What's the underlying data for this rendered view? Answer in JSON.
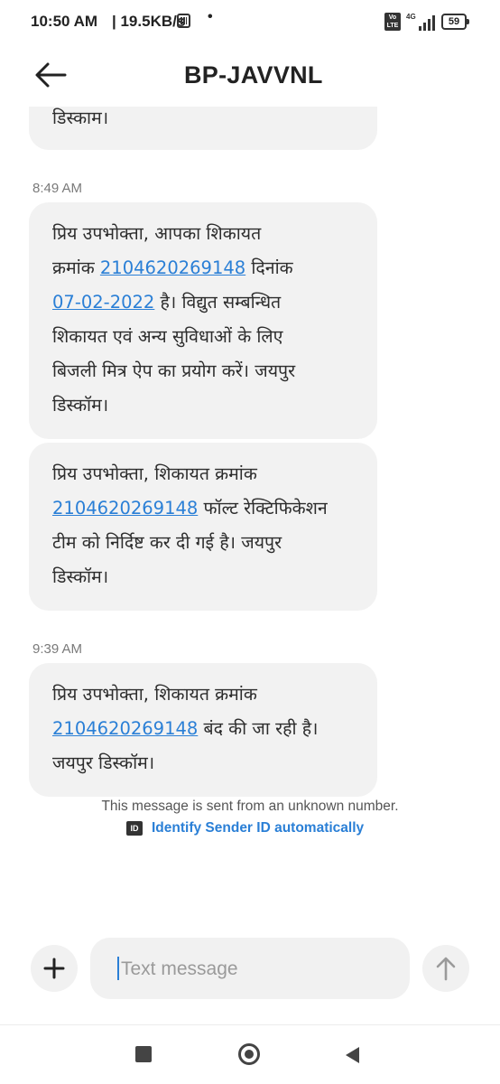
{
  "status_bar": {
    "time": "10:50 AM",
    "speed": "| 19.5KB/s",
    "dot": "•",
    "volte_label": "Vo LTE",
    "network": "4G",
    "battery": "59"
  },
  "header": {
    "title": "BP-JAVVNL",
    "back_icon": "arrow-left-icon"
  },
  "messages": [
    {
      "partial_text": "डिस्काम।"
    },
    {
      "timestamp": "8:49 AM",
      "line1": "प्रिय उपभोक्ता, आपका शिकायत",
      "line2_pre": "क्रमांक ",
      "line2_link": "2104620269148",
      "line2_post": " दिनांक",
      "line3_link": "07-02-2022",
      "line3_post": " है। विद्युत सम्बन्धित",
      "line4": "शिकायत एवं अन्य सुविधाओं के लिए",
      "line5": "बिजली मित्र ऐप का प्रयोग करें। जयपुर",
      "line6": "डिस्कॉम।"
    },
    {
      "line1": "प्रिय उपभोक्ता, शिकायत क्रमांक",
      "line2_link": "2104620269148",
      "line2_post": " फॉल्ट रेक्टिफिकेशन",
      "line3": "टीम को निर्दिष्ट कर दी गई है। जयपुर",
      "line4": "डिस्कॉम।"
    },
    {
      "timestamp": "9:39 AM",
      "line1": "प्रिय उपभोक्ता, शिकायत क्रमांक",
      "line2_link": "2104620269148",
      "line2_post": " बंद की जा रही है।",
      "line3": "जयपुर डिस्कॉम।"
    }
  ],
  "notice": {
    "text": "This message is sent from an unknown number.",
    "id_badge": "ID",
    "identify_label": "Identify Sender ID automatically"
  },
  "composer": {
    "placeholder": "Text message",
    "add_icon": "plus-icon",
    "send_icon": "arrow-up-icon"
  },
  "navbar": {
    "recent_icon": "square-icon",
    "home_icon": "circle-icon",
    "back_icon": "triangle-back-icon"
  },
  "colors": {
    "link": "#2a7fd6",
    "bubble": "#f2f2f2",
    "background": "#ffffff"
  }
}
